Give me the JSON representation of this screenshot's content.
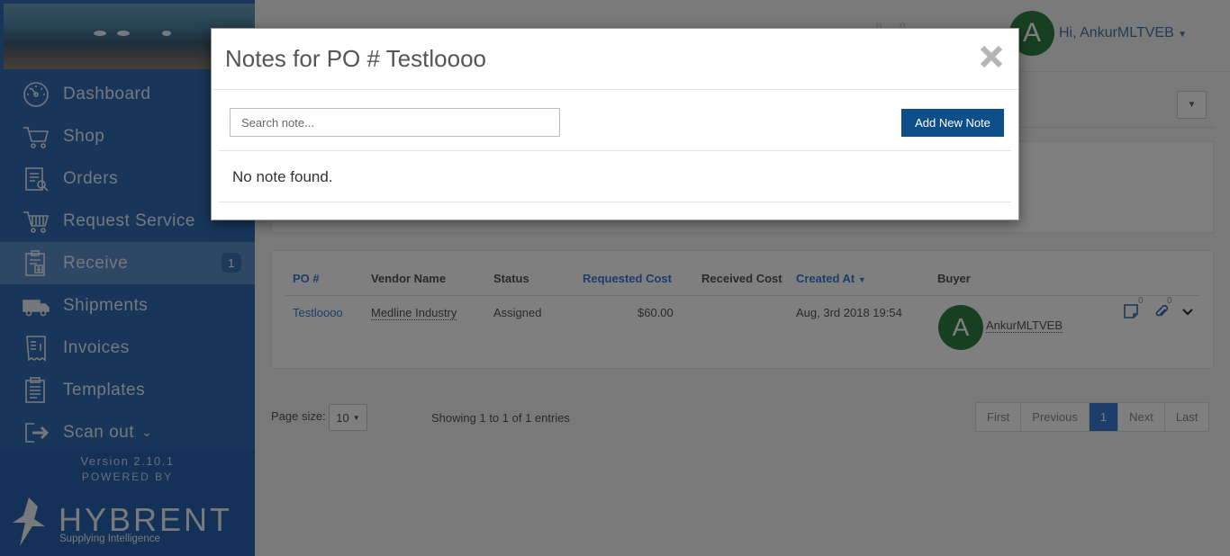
{
  "sidebar": {
    "items": [
      {
        "label": "Dashboard",
        "icon": "dashboard-icon"
      },
      {
        "label": "Shop",
        "icon": "cart-icon"
      },
      {
        "label": "Orders",
        "icon": "orders-icon"
      },
      {
        "label": "Request Service",
        "icon": "request-service-icon"
      },
      {
        "label": "Receive",
        "icon": "receive-icon",
        "badge": "1",
        "active": true
      },
      {
        "label": "Shipments",
        "icon": "truck-icon"
      },
      {
        "label": "Invoices",
        "icon": "invoice-icon"
      },
      {
        "label": "Templates",
        "icon": "templates-icon"
      },
      {
        "label": "Scan out",
        "icon": "scan-out-icon"
      }
    ],
    "version": "Version 2.10.1",
    "powered_by": "POWERED BY",
    "logo_text": "HYBRENT",
    "logo_tagline": "Supplying Intelligence"
  },
  "topbar": {
    "notification_counts": [
      "0",
      "0"
    ],
    "user_initial": "A",
    "user_greeting": "Hi, AnkurMLTVEB"
  },
  "table": {
    "headers": [
      "PO #",
      "Vendor Name",
      "Status",
      "Requested Cost",
      "Received Cost",
      "Created At",
      "Buyer"
    ],
    "row": {
      "po": "Testloooo",
      "vendor": "Medline Industry",
      "status": "Assigned",
      "requested_cost": "$60.00",
      "received_cost": "",
      "created_at": "Aug, 3rd 2018 19:54",
      "buyer_initial": "A",
      "buyer": "AnkurMLTVEB",
      "notes_count": "0",
      "attachments_count": "0"
    }
  },
  "pagination": {
    "page_size_label": "Page size:",
    "page_size": "10",
    "showing": "Showing 1 to 1 of 1 entries",
    "buttons": [
      "First",
      "Previous",
      "1",
      "Next",
      "Last"
    ]
  },
  "modal": {
    "title": "Notes for PO # Testloooo",
    "search_placeholder": "Search note...",
    "add_button": "Add New Note",
    "empty_message": "No note found."
  },
  "colors": {
    "sidebar": "#2e6db5",
    "accent": "#3a7bd5",
    "primary_button": "#0e4f8a",
    "avatar": "#2f8047"
  }
}
